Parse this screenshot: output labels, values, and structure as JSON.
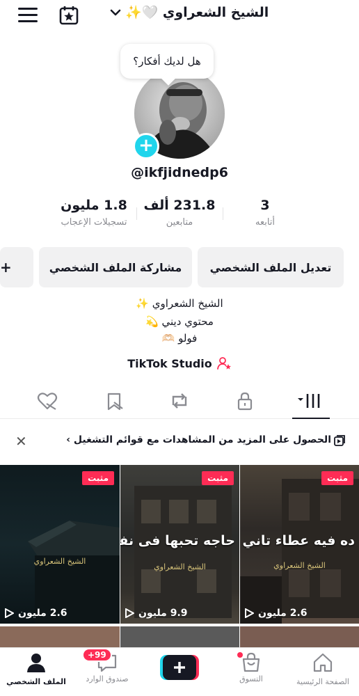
{
  "header": {
    "profile_name": "الشيخ الشعراوي 🤍✨",
    "menu_icon": "hamburger-menu-icon",
    "calendar_icon": "calendar-star-icon"
  },
  "profile": {
    "bubble_text": "هل لديك أفكار؟",
    "username": "@ikfjidnedp6",
    "stats": {
      "following": {
        "value": "3",
        "label": "أتابعه"
      },
      "followers": {
        "value": "231.8 ألف",
        "label": "متابعين"
      },
      "likes": {
        "value": "1.8 مليون",
        "label": "تسجيلات الإعجاب"
      }
    },
    "buttons": {
      "edit": "تعديل الملف الشخصي",
      "share": "مشاركة الملف الشخصي",
      "add_friend": "+"
    },
    "bio": [
      "الشيخ الشعراوي ✨",
      "محتوي ديني 💫",
      "فولو 🫶🏻"
    ],
    "studio": "TikTok Studio"
  },
  "banner": {
    "text": "الحصول على المزيد من المشاهدات مع قوائم التشغيل",
    "chevron": "›"
  },
  "videos": [
    {
      "pinned": "مثبت",
      "views": "2.6 مليون",
      "overlay": "ده فيه عطاء تاني",
      "signature": "الشيخ الشعراوي"
    },
    {
      "pinned": "مثبت",
      "views": "9.9 مليون",
      "overlay": "حاجه تحبها فى نفسك",
      "signature": "الشيخ الشعراوي"
    },
    {
      "pinned": "مثبت",
      "views": "2.6 مليون",
      "overlay": "",
      "signature": "الشيخ الشعراوي"
    }
  ],
  "nav": {
    "home": "الصفحة الرئيسية",
    "shop": "التسوق",
    "inbox": "صندوق الوارد",
    "inbox_badge": "+99",
    "profile": "الملف الشخصي"
  },
  "colors": {
    "accent": "#fe2c55",
    "cyan": "#20d5ec",
    "text": "#161823"
  }
}
